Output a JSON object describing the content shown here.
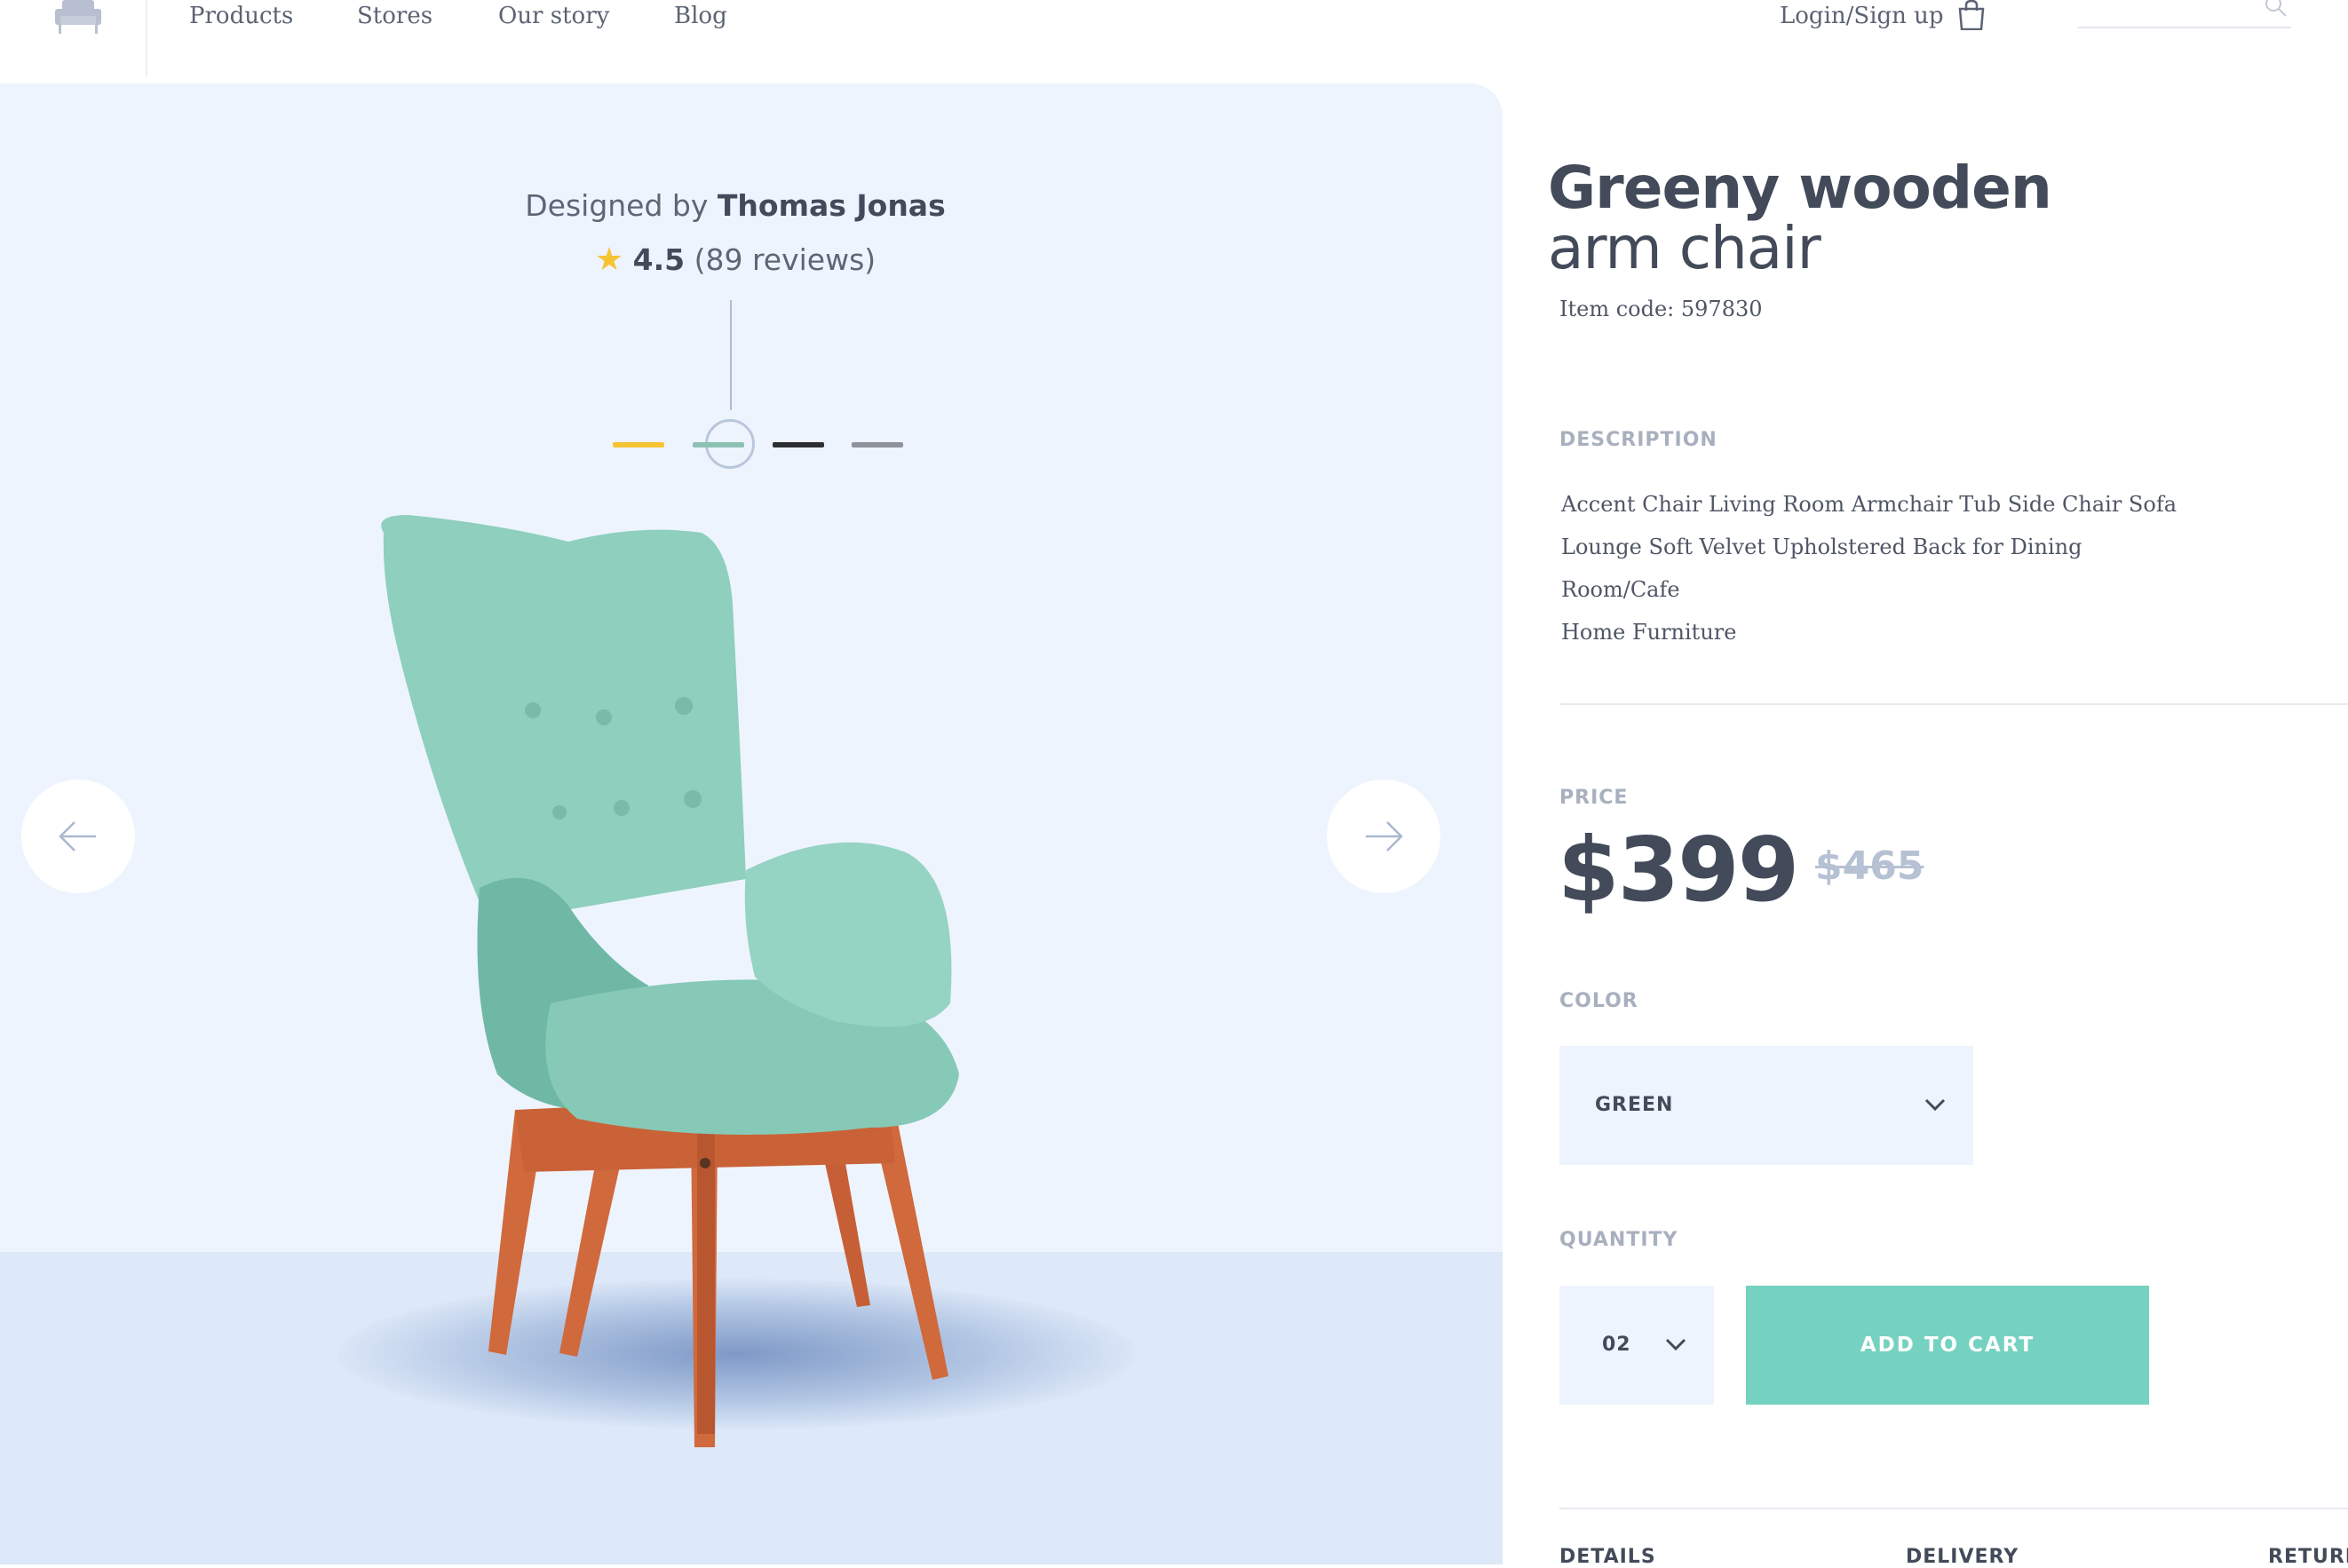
{
  "header": {
    "logo_icon": "armchair-logo-icon",
    "nav": [
      {
        "label": "Products"
      },
      {
        "label": "Stores"
      },
      {
        "label": "Our story"
      },
      {
        "label": "Blog"
      }
    ],
    "login_label": "Login/Sign up",
    "cart_icon": "shopping-bag-icon",
    "search_icon": "search-icon",
    "search_placeholder": ""
  },
  "gallery": {
    "designed_prefix": "Designed by",
    "designer": "Thomas Jonas",
    "rating": "4.5",
    "reviews": "(89 reviews)",
    "star_icon": "star-icon",
    "swatches": [
      {
        "name": "yellow",
        "color": "#f6c433"
      },
      {
        "name": "green",
        "color": "#8bc1b3",
        "selected": true
      },
      {
        "name": "black",
        "color": "#2d2f33"
      },
      {
        "name": "gray",
        "color": "#8d929b"
      }
    ],
    "prev_icon": "arrow-left-icon",
    "next_icon": "arrow-right-icon"
  },
  "product": {
    "title_bold": "Greeny wooden",
    "title_light": "arm chair",
    "item_code": "Item code: 597830",
    "description_label": "DESCRIPTION",
    "description_lines": [
      "Accent Chair Living Room Armchair Tub Side Chair Sofa",
      "Lounge Soft Velvet Upholstered Back for Dining Room/Cafe",
      "Home Furniture"
    ],
    "price_label": "PRICE",
    "price": "$399",
    "old_price": "$465",
    "color_label": "COLOR",
    "color_value": "GREEN",
    "quantity_label": "QUANTITY",
    "quantity_value": "02",
    "add_to_cart": "ADD TO CART",
    "tabs": [
      "DETAILS",
      "DELIVERY",
      "RETURN"
    ]
  },
  "colors": {
    "accent": "#75d2c0",
    "panel_bg": "#eef4fe",
    "text_dark": "#434b5a"
  }
}
